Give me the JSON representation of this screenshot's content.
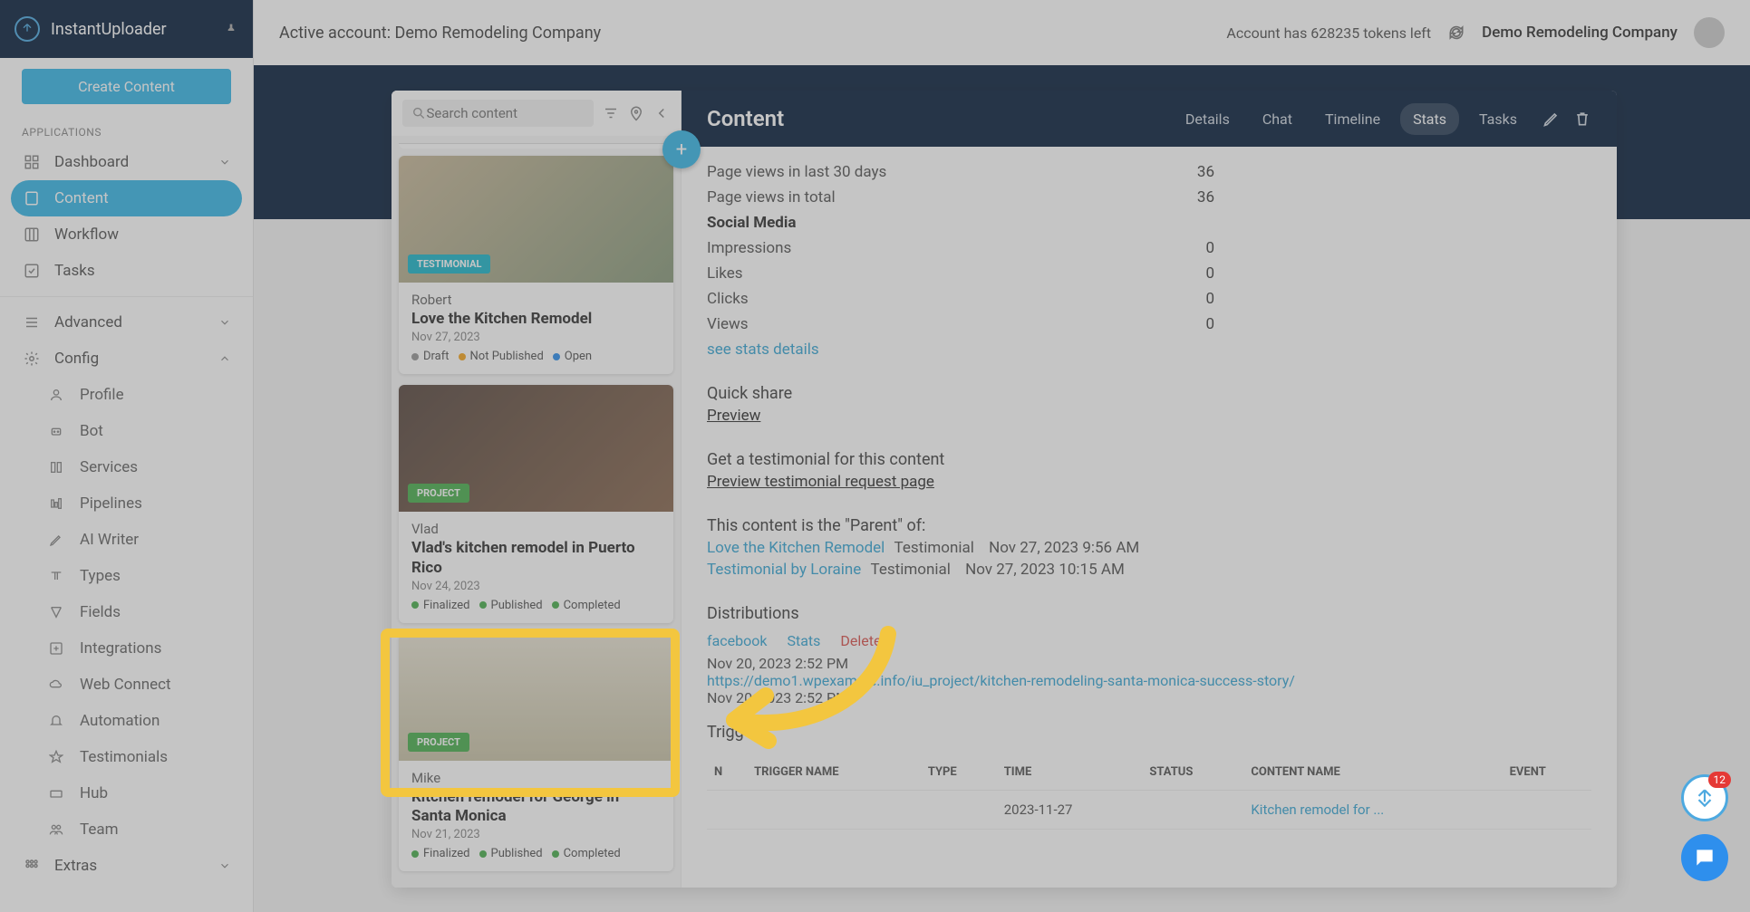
{
  "brand": "InstantUploader",
  "create_button": "Create Content",
  "nav": {
    "section_apps": "APPLICATIONS",
    "dashboard": "Dashboard",
    "content": "Content",
    "workflow": "Workflow",
    "tasks": "Tasks",
    "advanced": "Advanced",
    "config": "Config",
    "profile": "Profile",
    "bot": "Bot",
    "services": "Services",
    "pipelines": "Pipelines",
    "ai_writer": "AI Writer",
    "types": "Types",
    "fields": "Fields",
    "integrations": "Integrations",
    "web_connect": "Web Connect",
    "automation": "Automation",
    "testimonials": "Testimonials",
    "hub": "Hub",
    "team": "Team",
    "extras": "Extras"
  },
  "topbar": {
    "active_account": "Active account: Demo Remodeling Company",
    "tokens": "Account has 628235 tokens left",
    "company": "Demo Remodeling Company"
  },
  "search": {
    "placeholder": "Search content"
  },
  "cards": [
    {
      "tag": "TESTIMONIAL",
      "author": "Robert",
      "title": "Love the Kitchen Remodel",
      "date": "Nov 27, 2023",
      "statuses": [
        {
          "dot": "gray",
          "label": "Draft"
        },
        {
          "dot": "orange",
          "label": "Not Published"
        },
        {
          "dot": "blue",
          "label": "Open"
        }
      ]
    },
    {
      "tag": "PROJECT",
      "author": "Vlad",
      "title": "Vlad's kitchen remodel in Puerto Rico",
      "date": "Nov 24, 2023",
      "statuses": [
        {
          "dot": "green",
          "label": "Finalized"
        },
        {
          "dot": "green",
          "label": "Published"
        },
        {
          "dot": "green",
          "label": "Completed"
        }
      ]
    },
    {
      "tag": "PROJECT",
      "author": "Mike",
      "title": "Kitchen remodel for George in Santa Monica",
      "date": "Nov 21, 2023",
      "statuses": [
        {
          "dot": "green",
          "label": "Finalized"
        },
        {
          "dot": "green",
          "label": "Published"
        },
        {
          "dot": "green",
          "label": "Completed"
        }
      ]
    }
  ],
  "detail": {
    "heading": "Content",
    "tabs": {
      "details": "Details",
      "chat": "Chat",
      "timeline": "Timeline",
      "stats": "Stats",
      "tasks": "Tasks"
    },
    "stats": {
      "row1_label": "Page views in last 30 days",
      "row1_val": "36",
      "row2_label": "Page views in total",
      "row2_val": "36",
      "social_heading": "Social Media",
      "imp_label": "Impressions",
      "imp_val": "0",
      "likes_label": "Likes",
      "likes_val": "0",
      "clicks_label": "Clicks",
      "clicks_val": "0",
      "views_label": "Views",
      "views_val": "0",
      "see_details": "see stats details"
    },
    "quick_share": "Quick share",
    "preview": "Preview",
    "get_testimonial": "Get a testimonial for this content",
    "preview_testimonial": "Preview testimonial request page",
    "parent_of": "This content is the \"Parent\" of:",
    "child1_link": "Love the Kitchen Remodel",
    "child1_type": "Testimonial",
    "child1_date": "Nov 27, 2023 9:56 AM",
    "child2_link": "Testimonial by Loraine",
    "child2_type": "Testimonial",
    "child2_date": "Nov 27, 2023 10:15 AM",
    "distributions_h": "Distributions",
    "dist_fb": "facebook",
    "dist_stats": "Stats",
    "dist_delete": "Delete",
    "dist_ts1": "Nov 20, 2023 2:52 PM",
    "dist_url": "https://demo1.wpexample.info/iu_project/kitchen-remodeling-santa-monica-success-story/",
    "dist_ts2": "Nov 20, 2023 2:52 PM",
    "triggers_h": "Triggers",
    "th_n": "N",
    "th_name": "TRIGGER NAME",
    "th_type": "TYPE",
    "th_time": "TIME",
    "th_status": "STATUS",
    "th_content": "CONTENT NAME",
    "th_event": "EVENT",
    "tr_time": "2023-11-27",
    "tr_content": "Kitchen remodel for ..."
  },
  "badge_count": "12"
}
